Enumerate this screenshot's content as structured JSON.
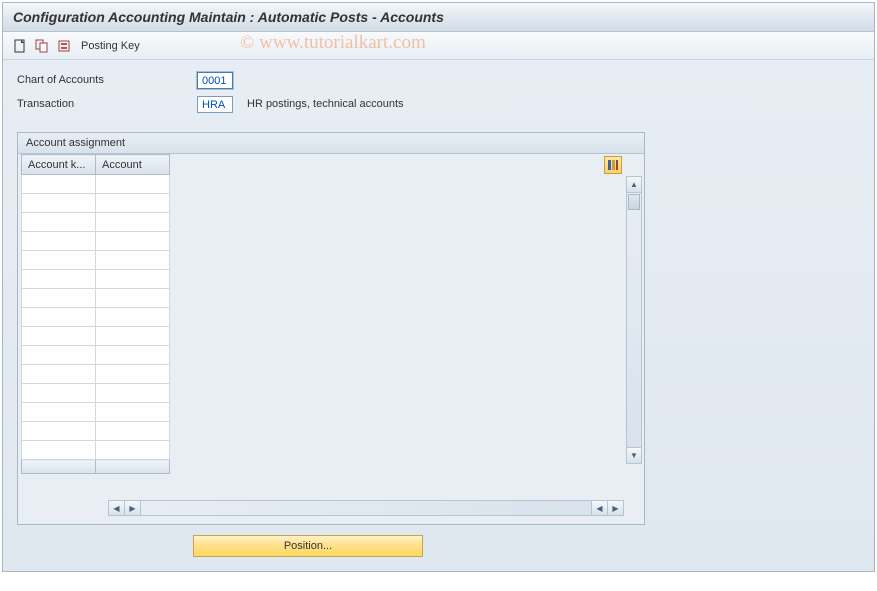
{
  "title": "Configuration Accounting Maintain : Automatic Posts - Accounts",
  "toolbar": {
    "posting_key_label": "Posting Key"
  },
  "form": {
    "chart_of_accounts": {
      "label": "Chart of Accounts",
      "value": "0001"
    },
    "transaction": {
      "label": "Transaction",
      "value": "HRA",
      "desc": "HR postings, technical accounts"
    }
  },
  "panel": {
    "header": "Account assignment",
    "columns": [
      "Account k...",
      "Account"
    ],
    "rows": [
      {
        "key": "",
        "account": ""
      },
      {
        "key": "",
        "account": ""
      },
      {
        "key": "",
        "account": ""
      },
      {
        "key": "",
        "account": ""
      },
      {
        "key": "",
        "account": ""
      },
      {
        "key": "",
        "account": ""
      },
      {
        "key": "",
        "account": ""
      },
      {
        "key": "",
        "account": ""
      },
      {
        "key": "",
        "account": ""
      },
      {
        "key": "",
        "account": ""
      },
      {
        "key": "",
        "account": ""
      },
      {
        "key": "",
        "account": ""
      },
      {
        "key": "",
        "account": ""
      },
      {
        "key": "",
        "account": ""
      },
      {
        "key": "",
        "account": ""
      }
    ]
  },
  "position_button": "Position...",
  "watermark": "© www.tutorialkart.com"
}
